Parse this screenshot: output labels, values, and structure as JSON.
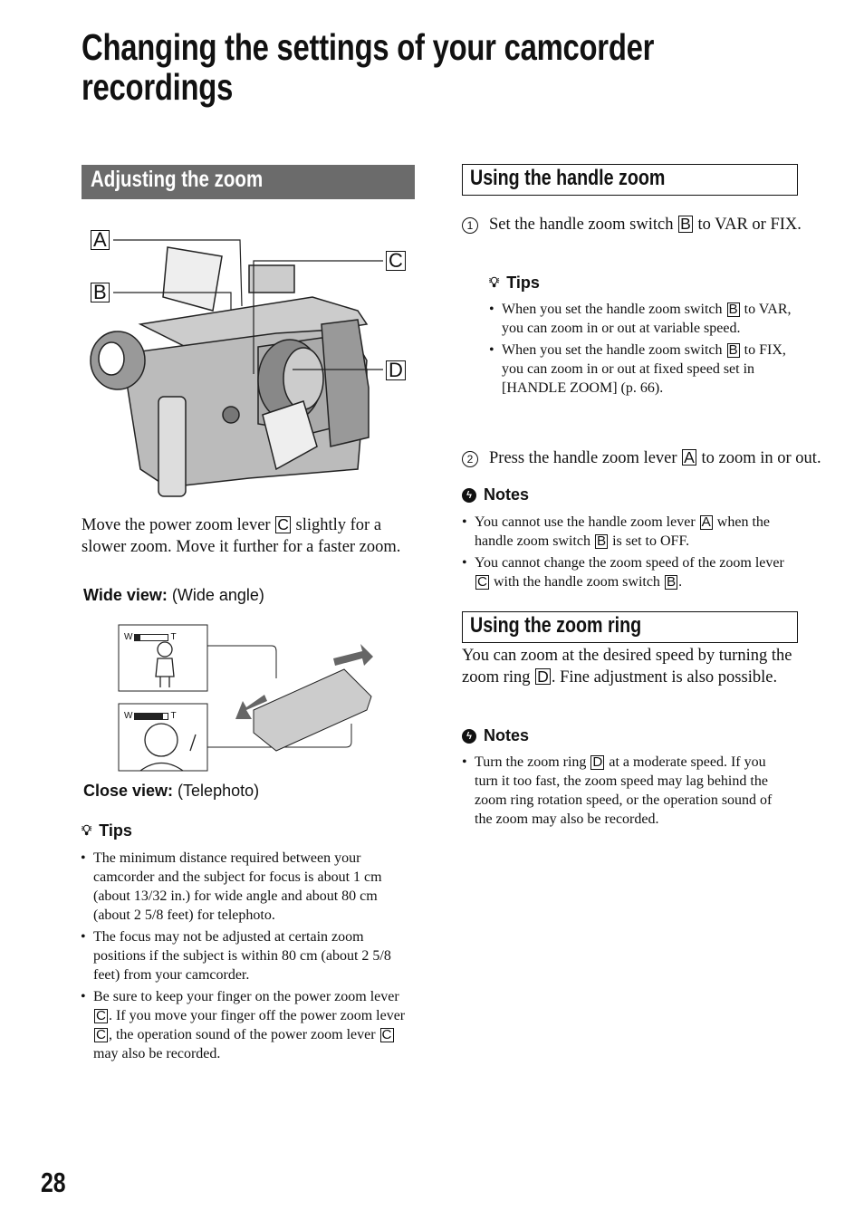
{
  "page": {
    "title_line1": "Changing the settings of your camcorder",
    "title_line2": "recordings",
    "page_number": "28"
  },
  "left": {
    "header": "Adjusting the zoom",
    "figure_labels": [
      "A",
      "B",
      "C",
      "D"
    ],
    "intro": [
      "Move the power zoom lever ",
      {
        "box": "C"
      },
      " slightly for a slower zoom. Move it further for a faster zoom."
    ],
    "wide_view_bold": "Wide view:",
    "wide_view_rest": " (Wide angle)",
    "close_view_bold": "Close view:",
    "close_view_rest": " (Telephoto)",
    "zoom_indicator_w": "W",
    "zoom_indicator_t": "T",
    "wide_fill": 0.15,
    "close_fill": 0.85,
    "tips_label": "Tips",
    "tips": [
      [
        "The minimum distance required between your camcorder and the subject for focus is about 1 cm (about 13/32 in.) for wide angle and about 80 cm (about 2 5/8 feet) for telephoto."
      ],
      [
        "The focus may not be adjusted at certain zoom positions if the subject is within 80 cm (about 2 5/8 feet) from your camcorder."
      ],
      [
        "Be sure to keep your finger on the power zoom lever ",
        {
          "box": "C"
        },
        ". If you move your finger off the power zoom lever ",
        {
          "box": "C"
        },
        ", the operation sound of the power zoom lever ",
        {
          "box": "C"
        },
        " may also be recorded."
      ]
    ]
  },
  "right": {
    "handle_header": "Using the handle zoom",
    "step1_num": "1",
    "step1": [
      "Set the handle zoom switch ",
      {
        "box": "B"
      },
      " to VAR or FIX."
    ],
    "tips_label": "Tips",
    "tips": [
      [
        "When you set the handle zoom switch ",
        {
          "box": "B"
        },
        " to VAR, you can zoom in or out at variable speed."
      ],
      [
        "When you set the handle zoom switch ",
        {
          "box": "B"
        },
        " to FIX, you can zoom in or out at fixed speed set in [HANDLE ZOOM] (p. 66)."
      ]
    ],
    "step2_num": "2",
    "step2": [
      "Press the handle zoom lever ",
      {
        "box": "A"
      },
      " to zoom in or out."
    ],
    "notes_label": "Notes",
    "notes": [
      [
        "You cannot use the handle zoom lever ",
        {
          "box": "A"
        },
        " when the handle zoom switch ",
        {
          "box": "B"
        },
        " is set to OFF."
      ],
      [
        "You cannot change the zoom speed of the zoom lever ",
        {
          "box": "C"
        },
        " with the handle zoom switch ",
        {
          "box": "B"
        },
        "."
      ]
    ],
    "ring_header": "Using the zoom ring",
    "ring_intro": [
      "You can zoom at the desired speed by turning the zoom ring ",
      {
        "box": "D"
      },
      ". Fine adjustment is also possible."
    ],
    "notes2_label": "Notes",
    "notes2": [
      [
        "Turn the zoom ring ",
        {
          "box": "D"
        },
        " at a moderate speed. If you turn it too fast, the zoom speed may lag behind the zoom ring rotation speed, or the operation sound of the zoom may also be recorded."
      ]
    ]
  },
  "colors": {
    "header_bar": "#6b6b6b"
  }
}
